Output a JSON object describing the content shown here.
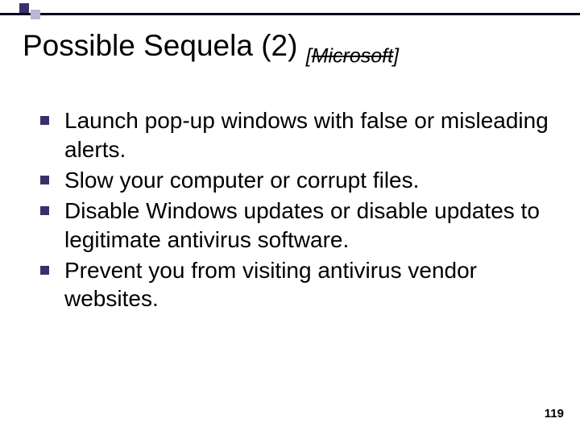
{
  "title": {
    "main": "Possible Sequela (2) ",
    "bracket_open": "[",
    "source": "Microsoft",
    "bracket_close": "]"
  },
  "bullets": [
    "Launch pop-up windows with false or misleading alerts.",
    "Slow your computer or corrupt files.",
    "Disable Windows updates or disable updates to legitimate antivirus software.",
    "Prevent you from visiting antivirus vendor websites."
  ],
  "page_number": "119"
}
